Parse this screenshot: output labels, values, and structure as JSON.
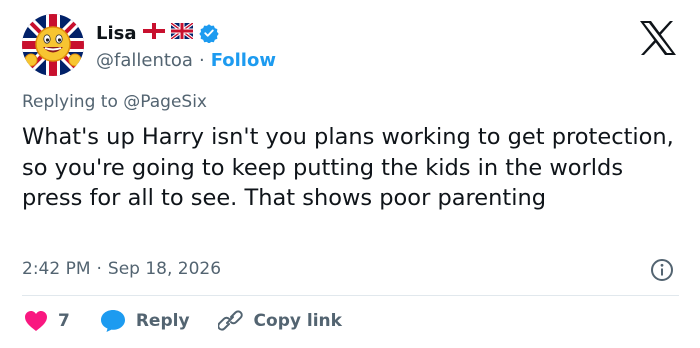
{
  "user": {
    "name": "Lisa",
    "flags": [
      "england-flag-icon",
      "uk-flag-icon"
    ],
    "handle": "@fallentoa",
    "separator": "·",
    "follow_label": "Follow"
  },
  "tweet": {
    "reply_prefix": "Replying to",
    "reply_mention": "@PageSix",
    "text": "What's up Harry isn't you plans working to get protection, so you're going to keep putting the kids in the worlds press for all to see. That shows poor parenting",
    "time": "2:42 PM",
    "separator": "·",
    "date": "Sep 18, 2026"
  },
  "actions": {
    "like_count": "7",
    "reply_label": "Reply",
    "copy_link_label": "Copy link"
  },
  "colors": {
    "accent": "#1d9bf0",
    "like": "#f91880",
    "text": "#0f1419",
    "muted": "#536471"
  },
  "icons": {
    "avatar": "smiley-union-jack-avatar",
    "verified": "verified-badge-icon",
    "brand": "x-logo-icon",
    "info": "info-icon",
    "like": "heart-icon",
    "reply": "speech-bubble-icon",
    "copy": "link-icon"
  }
}
